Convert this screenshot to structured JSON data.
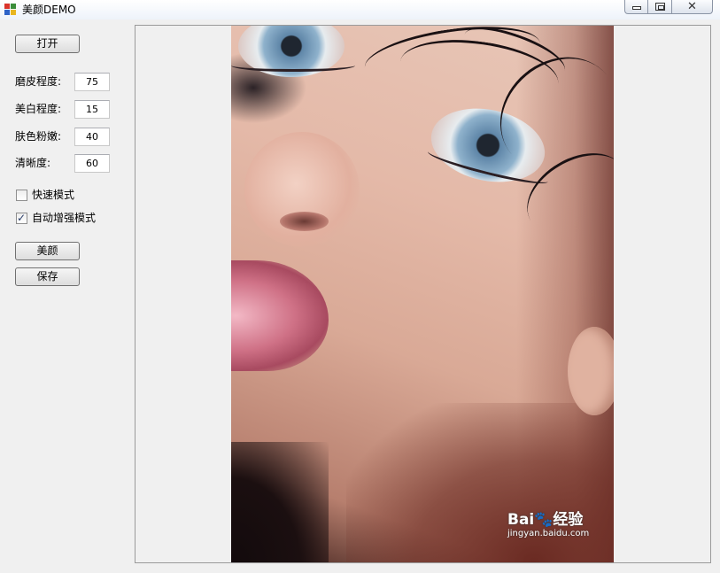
{
  "window": {
    "title": "美颜DEMO",
    "close_glyph": "✕"
  },
  "controls": {
    "open_label": "打开",
    "fields": [
      {
        "label": "磨皮程度:",
        "value": "75"
      },
      {
        "label": "美白程度:",
        "value": "15"
      },
      {
        "label": "肤色粉嫩:",
        "value": "40"
      },
      {
        "label": "清晰度:",
        "value": "60"
      }
    ],
    "checkboxes": [
      {
        "label": "快速模式",
        "checked": false
      },
      {
        "label": "自动增强模式",
        "checked": true,
        "mark": "✓"
      }
    ],
    "beautify_label": "美颜",
    "save_label": "保存"
  },
  "picture": {
    "watermark_logo": "Bai🐾经验",
    "watermark_url": "jingyan.baidu.com"
  }
}
